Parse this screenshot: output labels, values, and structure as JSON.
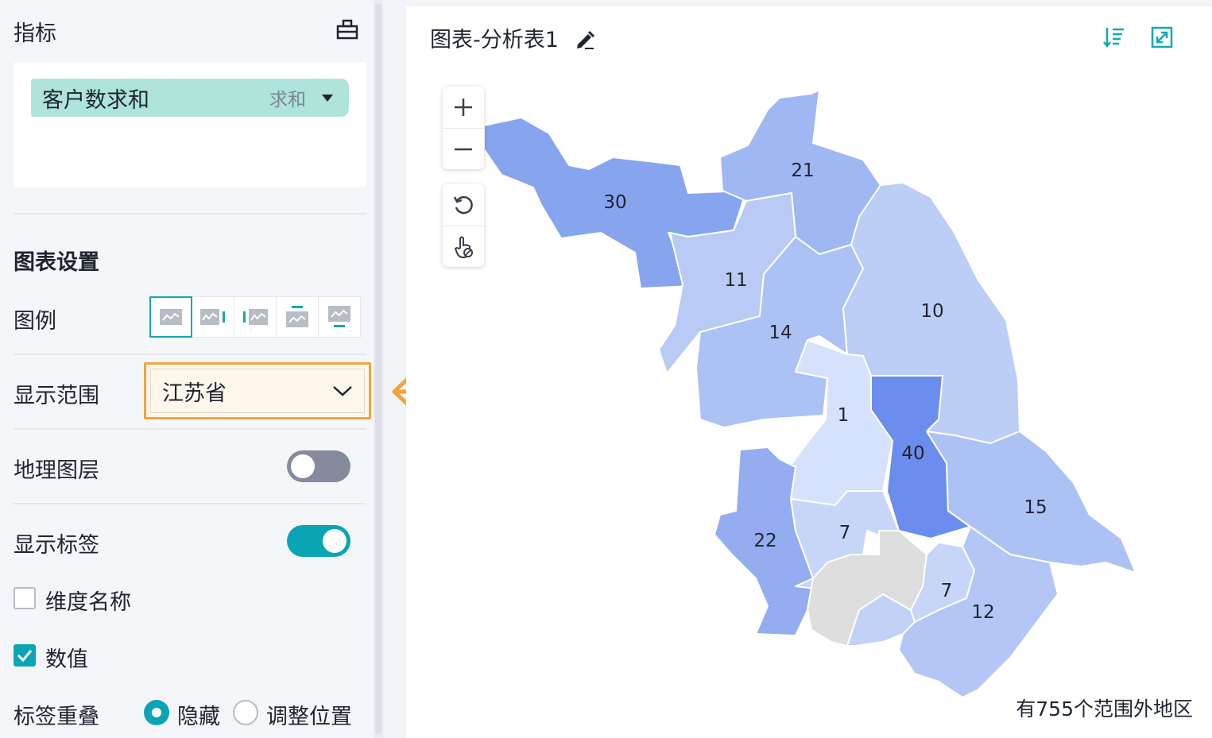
{
  "left_panel": {
    "metrics_title": "指标",
    "metric": {
      "name": "客户数求和",
      "aggregation": "求和"
    },
    "chart_settings_title": "图表设置",
    "legend": {
      "label": "图例",
      "options": [
        "legend-hidden-icon",
        "legend-right-icon",
        "legend-left-icon",
        "legend-top-icon",
        "legend-bottom-icon"
      ],
      "selected_index": 0
    },
    "display_range": {
      "label": "显示范围",
      "value": "江苏省"
    },
    "geo_layer": {
      "label": "地理图层",
      "enabled": false
    },
    "show_labels": {
      "label": "显示标签",
      "enabled": true
    },
    "dimension_name": {
      "label": "维度名称",
      "checked": false
    },
    "value": {
      "label": "数值",
      "checked": true
    },
    "label_overlap": {
      "label": "标签重叠",
      "options": [
        {
          "label": "隐藏",
          "selected": true
        },
        {
          "label": "调整位置",
          "selected": false
        }
      ]
    }
  },
  "chart": {
    "title": "图表-分析表1",
    "out_of_range_text": "有755个范围外地区",
    "regions": [
      {
        "id": "xuzhou",
        "value": 30,
        "color": "#87a4ef"
      },
      {
        "id": "lianyungang",
        "value": 21,
        "color": "#9fb7f2"
      },
      {
        "id": "suqian",
        "value": 11,
        "color": "#b9cbf5"
      },
      {
        "id": "huaian",
        "value": 14,
        "color": "#acc1f4"
      },
      {
        "id": "yancheng",
        "value": 10,
        "color": "#bccdf6"
      },
      {
        "id": "yangzhou",
        "value": 1,
        "color": "#d6e2fb"
      },
      {
        "id": "taizhou",
        "value": 40,
        "color": "#6b8ded"
      },
      {
        "id": "nantong",
        "value": 15,
        "color": "#adc2f4"
      },
      {
        "id": "nanjing",
        "value": 22,
        "color": "#93adf0"
      },
      {
        "id": "zhenjiang",
        "value": 7,
        "color": "#c7d6f8"
      },
      {
        "id": "changzhou",
        "value": 7,
        "color": "#c7d6f8"
      },
      {
        "id": "suzhou",
        "value": 12,
        "color": "#b3c6f5"
      },
      {
        "id": "wuxi",
        "value": null,
        "color": "#c2d2f7"
      },
      {
        "id": "no-data",
        "value": null,
        "color": "#dedede"
      }
    ]
  }
}
